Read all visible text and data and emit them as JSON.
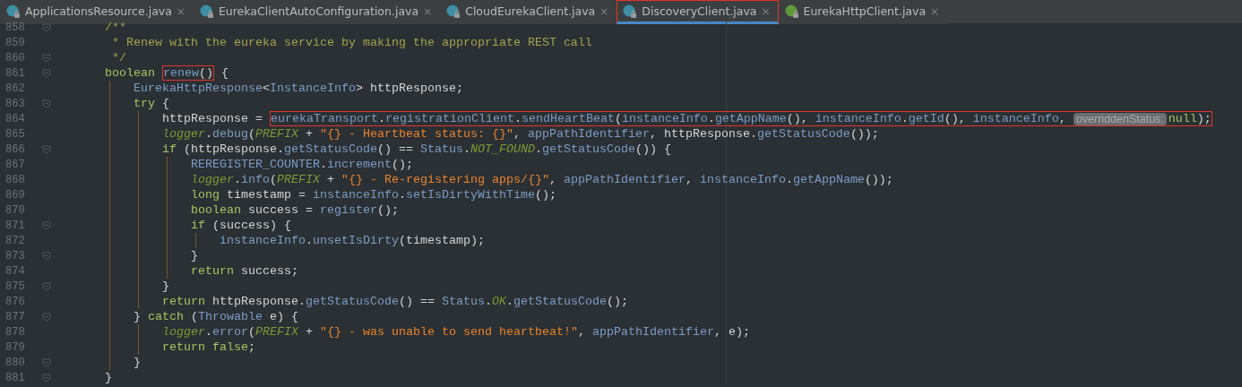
{
  "tabs": [
    {
      "label": "ApplicationsResource.java",
      "close": "×",
      "kind": "class",
      "selected": false,
      "boxed": false
    },
    {
      "label": "EurekaClientAutoConfiguration.java",
      "close": "×",
      "kind": "class",
      "selected": false,
      "boxed": false
    },
    {
      "label": "CloudEurekaClient.java",
      "close": "×",
      "kind": "class",
      "selected": false,
      "boxed": false
    },
    {
      "label": "DiscoveryClient.java",
      "close": "×",
      "kind": "class",
      "selected": true,
      "boxed": true
    },
    {
      "label": "EurekaHttpClient.java",
      "close": "×",
      "kind": "interface",
      "selected": false,
      "boxed": false
    }
  ],
  "editor": {
    "lines": [
      {
        "number": "858",
        "fold": true,
        "segments": [
          {
            "boxed": false,
            "tokens": [
              {
                "kind": "comment",
                "text": "    /**"
              }
            ]
          }
        ]
      },
      {
        "number": "859",
        "fold": false,
        "segments": [
          {
            "boxed": false,
            "tokens": [
              {
                "kind": "comment",
                "text": "     * Renew with the eureka service by making the appropriate REST call"
              }
            ]
          }
        ]
      },
      {
        "number": "860",
        "fold": true,
        "segments": [
          {
            "boxed": false,
            "tokens": [
              {
                "kind": "comment",
                "text": "     */"
              }
            ]
          }
        ]
      },
      {
        "number": "861",
        "fold": true,
        "segments": [
          {
            "boxed": false,
            "tokens": [
              {
                "kind": "keyword",
                "text": "    boolean "
              }
            ]
          },
          {
            "boxed": true,
            "tokens": [
              {
                "kind": "method",
                "text": "renew"
              },
              {
                "kind": "plain",
                "text": "()"
              }
            ]
          },
          {
            "boxed": false,
            "tokens": [
              {
                "kind": "plain",
                "text": " {"
              }
            ]
          }
        ]
      },
      {
        "number": "862",
        "fold": false,
        "segments": [
          {
            "boxed": false,
            "tokens": [
              {
                "kind": "type",
                "text": "        EurekaHttpResponse"
              },
              {
                "kind": "plain",
                "text": "<"
              },
              {
                "kind": "type",
                "text": "InstanceInfo"
              },
              {
                "kind": "plain",
                "text": "> httpResponse;"
              }
            ]
          }
        ]
      },
      {
        "number": "863",
        "fold": true,
        "segments": [
          {
            "boxed": false,
            "tokens": [
              {
                "kind": "keyword",
                "text": "        try"
              },
              {
                "kind": "plain",
                "text": " {"
              }
            ]
          }
        ]
      },
      {
        "number": "864",
        "fold": false,
        "segments": [
          {
            "boxed": false,
            "tokens": [
              {
                "kind": "plain",
                "text": "            httpResponse = "
              }
            ]
          },
          {
            "boxed": true,
            "tokens": [
              {
                "kind": "method",
                "text": "eurekaTransport"
              },
              {
                "kind": "plain",
                "text": "."
              },
              {
                "kind": "method",
                "text": "registrationClient"
              },
              {
                "kind": "plain",
                "text": "."
              },
              {
                "kind": "method",
                "text": "sendHeartBeat"
              },
              {
                "kind": "plain",
                "text": "("
              },
              {
                "kind": "method",
                "text": "instanceInfo"
              },
              {
                "kind": "plain",
                "text": "."
              },
              {
                "kind": "method",
                "text": "getAppName"
              },
              {
                "kind": "plain",
                "text": "(), "
              },
              {
                "kind": "method",
                "text": "instanceInfo"
              },
              {
                "kind": "plain",
                "text": "."
              },
              {
                "kind": "method",
                "text": "getId"
              },
              {
                "kind": "plain",
                "text": "(), "
              },
              {
                "kind": "method",
                "text": "instanceInfo"
              },
              {
                "kind": "plain",
                "text": ", "
              },
              {
                "kind": "hint",
                "text": "overriddenStatus:"
              },
              {
                "kind": "keyword",
                "text": "null"
              },
              {
                "kind": "plain",
                "text": ");"
              }
            ]
          }
        ]
      },
      {
        "number": "865",
        "fold": false,
        "segments": [
          {
            "boxed": false,
            "tokens": [
              {
                "kind": "static",
                "text": "            logger"
              },
              {
                "kind": "plain",
                "text": "."
              },
              {
                "kind": "method",
                "text": "debug"
              },
              {
                "kind": "plain",
                "text": "("
              },
              {
                "kind": "static",
                "text": "PREFIX"
              },
              {
                "kind": "plain",
                "text": " + "
              },
              {
                "kind": "string",
                "text": "\"{} - Heartbeat status: {}\""
              },
              {
                "kind": "plain",
                "text": ", "
              },
              {
                "kind": "method",
                "text": "appPathIdentifier"
              },
              {
                "kind": "plain",
                "text": ", httpResponse."
              },
              {
                "kind": "method",
                "text": "getStatusCode"
              },
              {
                "kind": "plain",
                "text": "());"
              }
            ]
          }
        ]
      },
      {
        "number": "866",
        "fold": true,
        "segments": [
          {
            "boxed": false,
            "tokens": [
              {
                "kind": "keyword",
                "text": "            if"
              },
              {
                "kind": "plain",
                "text": " (httpResponse."
              },
              {
                "kind": "method",
                "text": "getStatusCode"
              },
              {
                "kind": "plain",
                "text": "() == "
              },
              {
                "kind": "type",
                "text": "Status"
              },
              {
                "kind": "plain",
                "text": "."
              },
              {
                "kind": "static",
                "text": "NOT_FOUND"
              },
              {
                "kind": "plain",
                "text": "."
              },
              {
                "kind": "method",
                "text": "getStatusCode"
              },
              {
                "kind": "plain",
                "text": "()) {"
              }
            ]
          }
        ]
      },
      {
        "number": "867",
        "fold": false,
        "segments": [
          {
            "boxed": false,
            "tokens": [
              {
                "kind": "method",
                "text": "                REREGISTER_COUNTER"
              },
              {
                "kind": "plain",
                "text": "."
              },
              {
                "kind": "method",
                "text": "increment"
              },
              {
                "kind": "plain",
                "text": "();"
              }
            ]
          }
        ]
      },
      {
        "number": "868",
        "fold": false,
        "segments": [
          {
            "boxed": false,
            "tokens": [
              {
                "kind": "static",
                "text": "                logger"
              },
              {
                "kind": "plain",
                "text": "."
              },
              {
                "kind": "method",
                "text": "info"
              },
              {
                "kind": "plain",
                "text": "("
              },
              {
                "kind": "static",
                "text": "PREFIX"
              },
              {
                "kind": "plain",
                "text": " + "
              },
              {
                "kind": "string",
                "text": "\"{} - Re-registering apps/{}\""
              },
              {
                "kind": "plain",
                "text": ", "
              },
              {
                "kind": "method",
                "text": "appPathIdentifier"
              },
              {
                "kind": "plain",
                "text": ", "
              },
              {
                "kind": "method",
                "text": "instanceInfo"
              },
              {
                "kind": "plain",
                "text": "."
              },
              {
                "kind": "method",
                "text": "getAppName"
              },
              {
                "kind": "plain",
                "text": "());"
              }
            ]
          }
        ]
      },
      {
        "number": "869",
        "fold": false,
        "segments": [
          {
            "boxed": false,
            "tokens": [
              {
                "kind": "keyword",
                "text": "                long"
              },
              {
                "kind": "plain",
                "text": " timestamp = "
              },
              {
                "kind": "method",
                "text": "instanceInfo"
              },
              {
                "kind": "plain",
                "text": "."
              },
              {
                "kind": "method",
                "text": "setIsDirtyWithTime"
              },
              {
                "kind": "plain",
                "text": "();"
              }
            ]
          }
        ]
      },
      {
        "number": "870",
        "fold": false,
        "segments": [
          {
            "boxed": false,
            "tokens": [
              {
                "kind": "keyword",
                "text": "                boolean"
              },
              {
                "kind": "plain",
                "text": " success = "
              },
              {
                "kind": "method",
                "text": "register"
              },
              {
                "kind": "plain",
                "text": "();"
              }
            ]
          }
        ]
      },
      {
        "number": "871",
        "fold": true,
        "segments": [
          {
            "boxed": false,
            "tokens": [
              {
                "kind": "keyword",
                "text": "                if"
              },
              {
                "kind": "plain",
                "text": " (success) {"
              }
            ]
          }
        ]
      },
      {
        "number": "872",
        "fold": false,
        "segments": [
          {
            "boxed": false,
            "tokens": [
              {
                "kind": "method",
                "text": "                    instanceInfo"
              },
              {
                "kind": "plain",
                "text": "."
              },
              {
                "kind": "method",
                "text": "unsetIsDirty"
              },
              {
                "kind": "plain",
                "text": "(timestamp);"
              }
            ]
          }
        ]
      },
      {
        "number": "873",
        "fold": true,
        "segments": [
          {
            "boxed": false,
            "tokens": [
              {
                "kind": "plain",
                "text": "                }"
              }
            ]
          }
        ]
      },
      {
        "number": "874",
        "fold": false,
        "segments": [
          {
            "boxed": false,
            "tokens": [
              {
                "kind": "keyword",
                "text": "                return"
              },
              {
                "kind": "plain",
                "text": " success;"
              }
            ]
          }
        ]
      },
      {
        "number": "875",
        "fold": true,
        "segments": [
          {
            "boxed": false,
            "tokens": [
              {
                "kind": "plain",
                "text": "            }"
              }
            ]
          }
        ]
      },
      {
        "number": "876",
        "fold": false,
        "segments": [
          {
            "boxed": false,
            "tokens": [
              {
                "kind": "keyword",
                "text": "            return"
              },
              {
                "kind": "plain",
                "text": " httpResponse."
              },
              {
                "kind": "method",
                "text": "getStatusCode"
              },
              {
                "kind": "plain",
                "text": "() == "
              },
              {
                "kind": "type",
                "text": "Status"
              },
              {
                "kind": "plain",
                "text": "."
              },
              {
                "kind": "static",
                "text": "OK"
              },
              {
                "kind": "plain",
                "text": "."
              },
              {
                "kind": "method",
                "text": "getStatusCode"
              },
              {
                "kind": "plain",
                "text": "();"
              }
            ]
          }
        ]
      },
      {
        "number": "877",
        "fold": true,
        "segments": [
          {
            "boxed": false,
            "tokens": [
              {
                "kind": "plain",
                "text": "        } "
              },
              {
                "kind": "keyword",
                "text": "catch"
              },
              {
                "kind": "plain",
                "text": " ("
              },
              {
                "kind": "type",
                "text": "Throwable"
              },
              {
                "kind": "plain",
                "text": " e) {"
              }
            ]
          }
        ]
      },
      {
        "number": "878",
        "fold": false,
        "segments": [
          {
            "boxed": false,
            "tokens": [
              {
                "kind": "static",
                "text": "            logger"
              },
              {
                "kind": "plain",
                "text": "."
              },
              {
                "kind": "method",
                "text": "error"
              },
              {
                "kind": "plain",
                "text": "("
              },
              {
                "kind": "static",
                "text": "PREFIX"
              },
              {
                "kind": "plain",
                "text": " + "
              },
              {
                "kind": "string",
                "text": "\"{} - was unable to send heartbeat!\""
              },
              {
                "kind": "plain",
                "text": ", "
              },
              {
                "kind": "method",
                "text": "appPathIdentifier"
              },
              {
                "kind": "plain",
                "text": ", e);"
              }
            ]
          }
        ]
      },
      {
        "number": "879",
        "fold": false,
        "segments": [
          {
            "boxed": false,
            "tokens": [
              {
                "kind": "keyword",
                "text": "            return false"
              },
              {
                "kind": "plain",
                "text": ";"
              }
            ]
          }
        ]
      },
      {
        "number": "880",
        "fold": true,
        "segments": [
          {
            "boxed": false,
            "tokens": [
              {
                "kind": "plain",
                "text": "        }"
              }
            ]
          }
        ]
      },
      {
        "number": "881",
        "fold": true,
        "segments": [
          {
            "boxed": false,
            "tokens": [
              {
                "kind": "plain",
                "text": "    }"
              }
            ]
          }
        ]
      }
    ]
  }
}
